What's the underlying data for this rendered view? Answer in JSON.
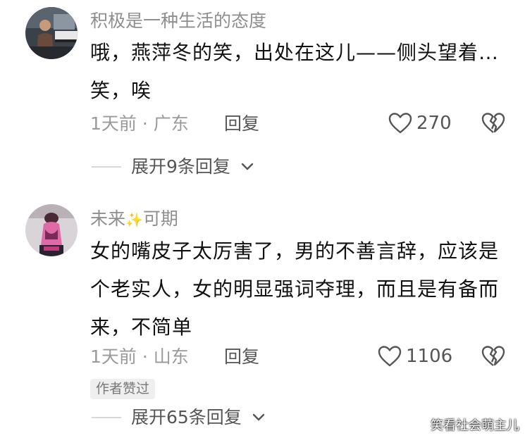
{
  "comments": [
    {
      "username": "积极是一种生活的态度",
      "text": "哦，燕萍冬的笑，出处在这儿——侧头望着…笑，唉",
      "time_location": "1天前 · 广东",
      "reply_label": "回复",
      "likes": "270",
      "expand_label": "展开9条回复",
      "avatar_icon": "person-at-piano-avatar"
    },
    {
      "username_prefix": "未来",
      "sparkle": "✨",
      "username_suffix": "可期",
      "text": "女的嘴皮子太厉害了，男的不善言辞，应该是个老实人，女的明显强词夺理，而且是有备而来，不简单",
      "time_location": "1天前 · 山东",
      "reply_label": "回复",
      "likes": "1106",
      "badge": "作者赞过",
      "expand_label": "展开65条回复",
      "avatar_icon": "pink-figure-avatar"
    }
  ],
  "watermark": "笑看社会萌主儿",
  "colors": {
    "text": "#111111",
    "meta": "#9a9a9a",
    "username": "#8e8e8e"
  }
}
